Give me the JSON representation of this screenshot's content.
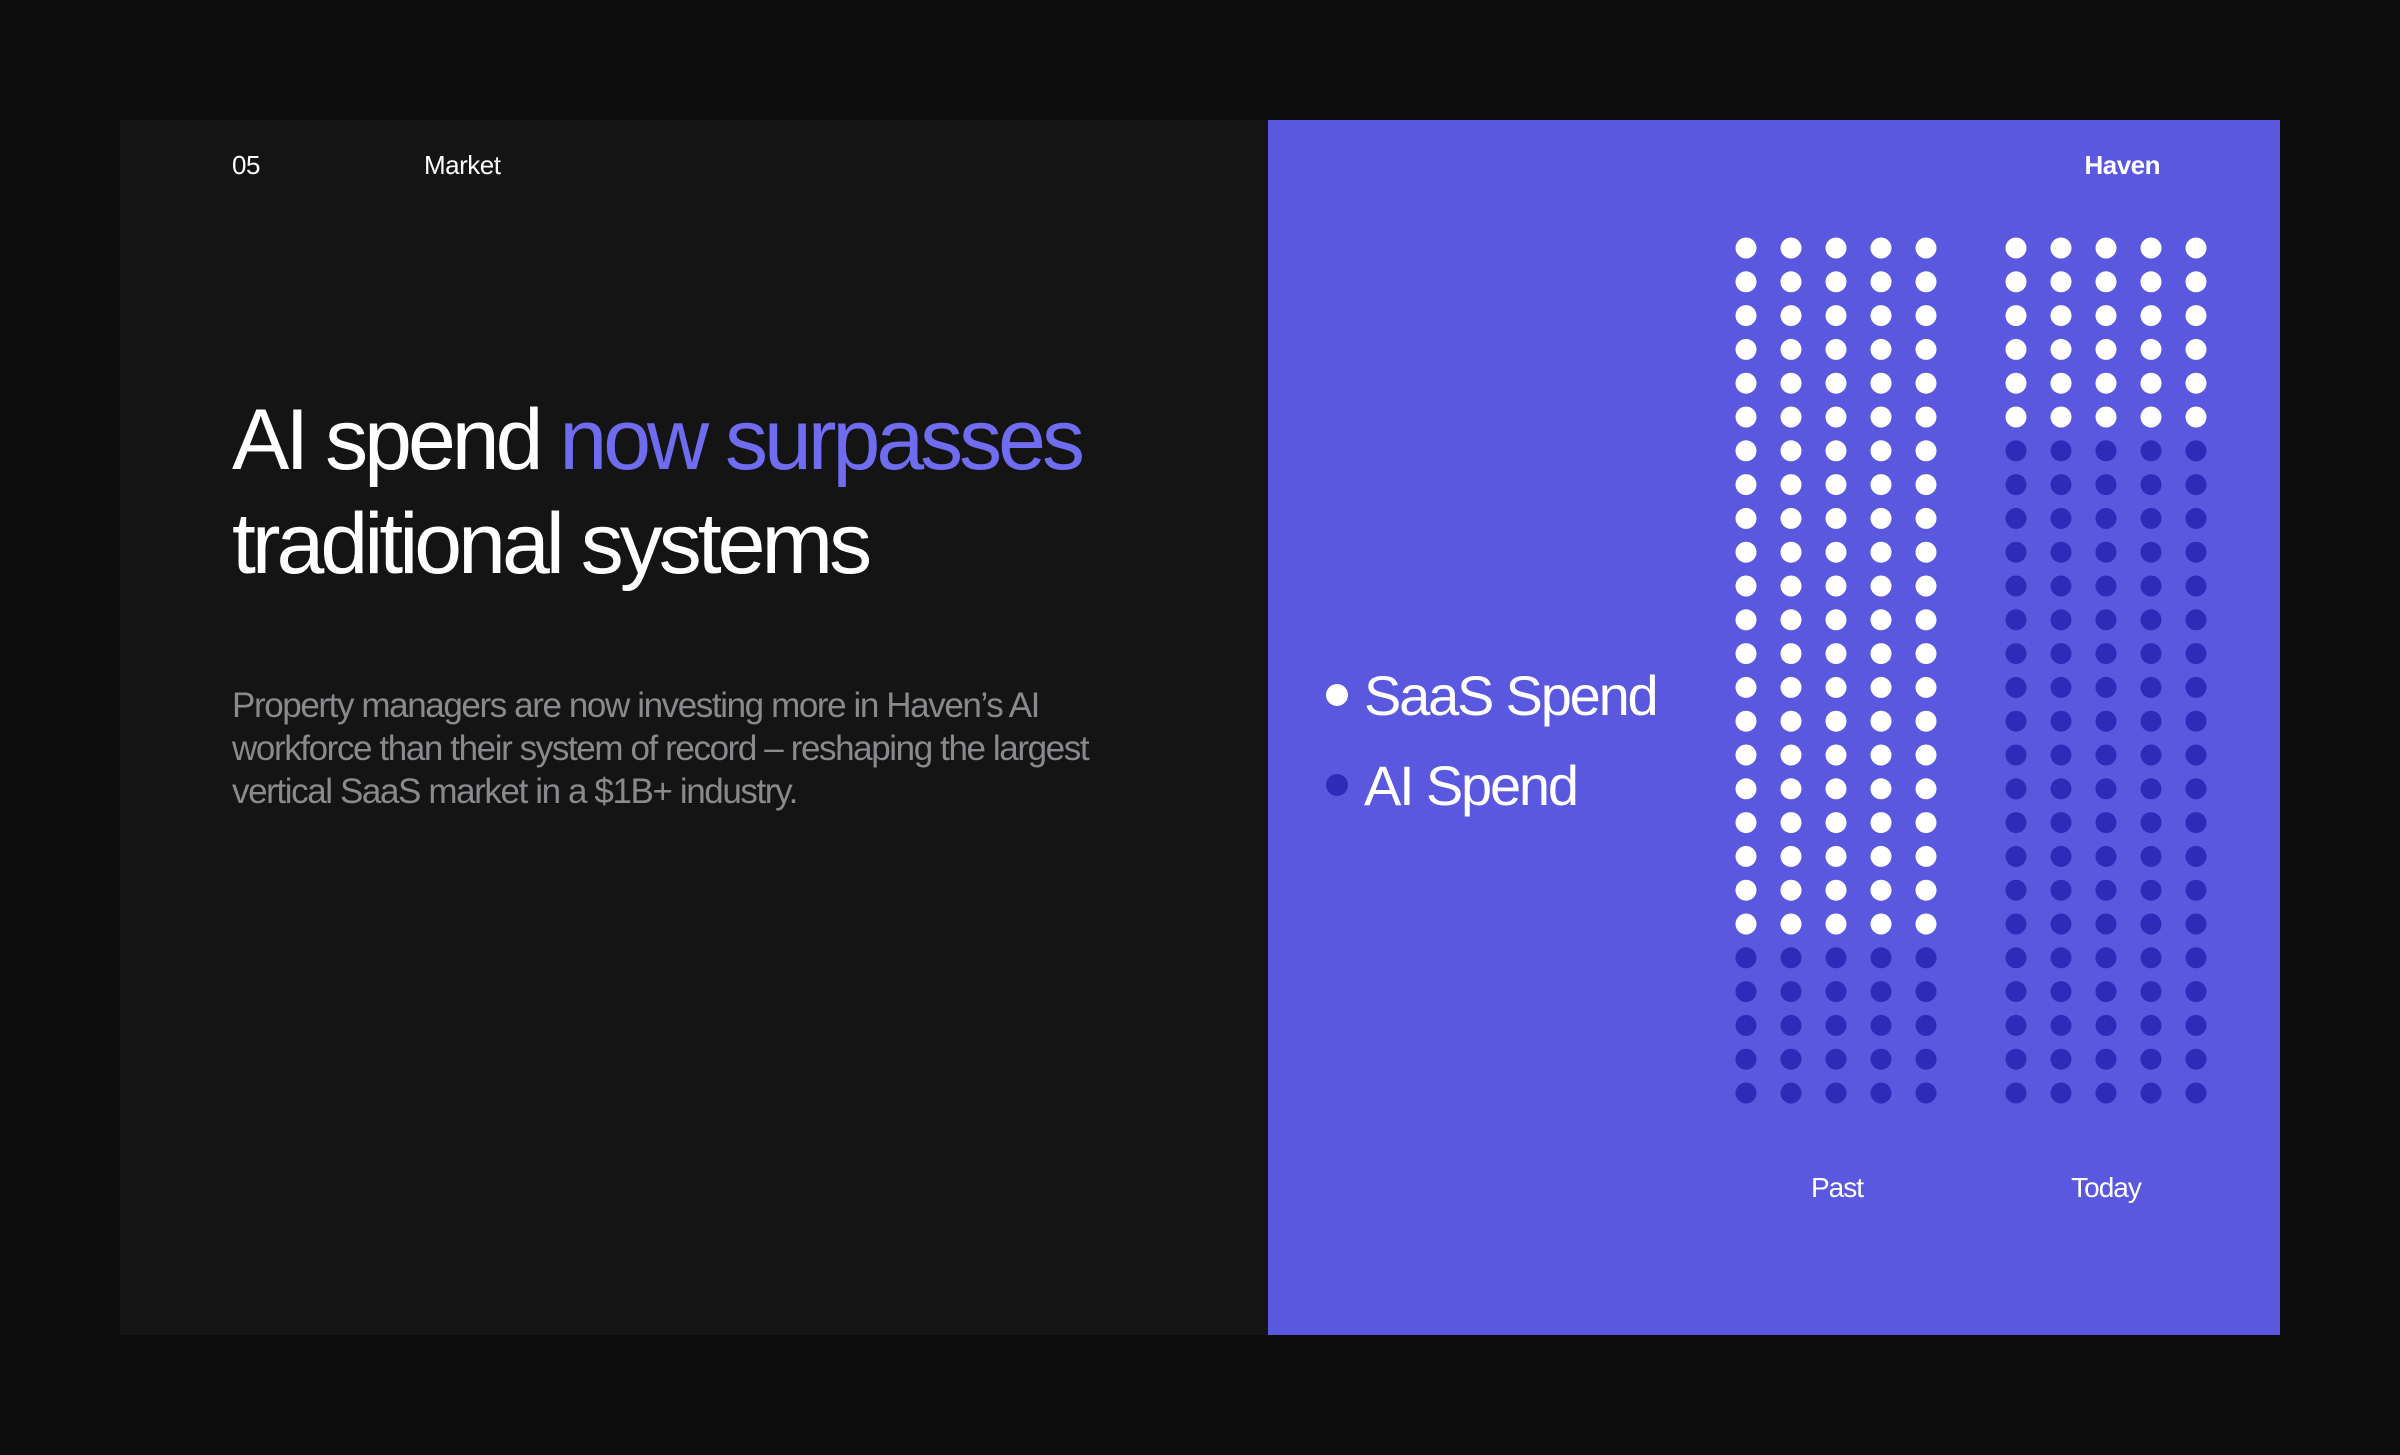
{
  "header": {
    "slide_number": "05",
    "section": "Market",
    "brand": "Haven"
  },
  "headline": {
    "part1": "AI spend ",
    "accent": "now surpasses",
    "part2": "traditional systems"
  },
  "body": "Property managers are now investing more in Haven’s AI workforce than their system of record – reshaping the largest vertical SaaS market in a $1B+ industry.",
  "colors": {
    "left_bg": "#141414",
    "right_bg": "#5a58df",
    "accent_text": "#6f6cf0",
    "saas_dot": "#ffffff",
    "ai_dot": "#2e2bb8"
  },
  "chart_data": {
    "type": "bar",
    "encoding": "dot-matrix",
    "categories": [
      "Past",
      "Today"
    ],
    "columns_per_bar": 5,
    "total_rows": 26,
    "series": [
      {
        "name": "SaaS Spend",
        "values": [
          21,
          6
        ],
        "color": "#ffffff"
      },
      {
        "name": "AI Spend",
        "values": [
          5,
          20
        ],
        "color": "#2e2bb8"
      }
    ],
    "legend_position": "left",
    "grid": false
  }
}
